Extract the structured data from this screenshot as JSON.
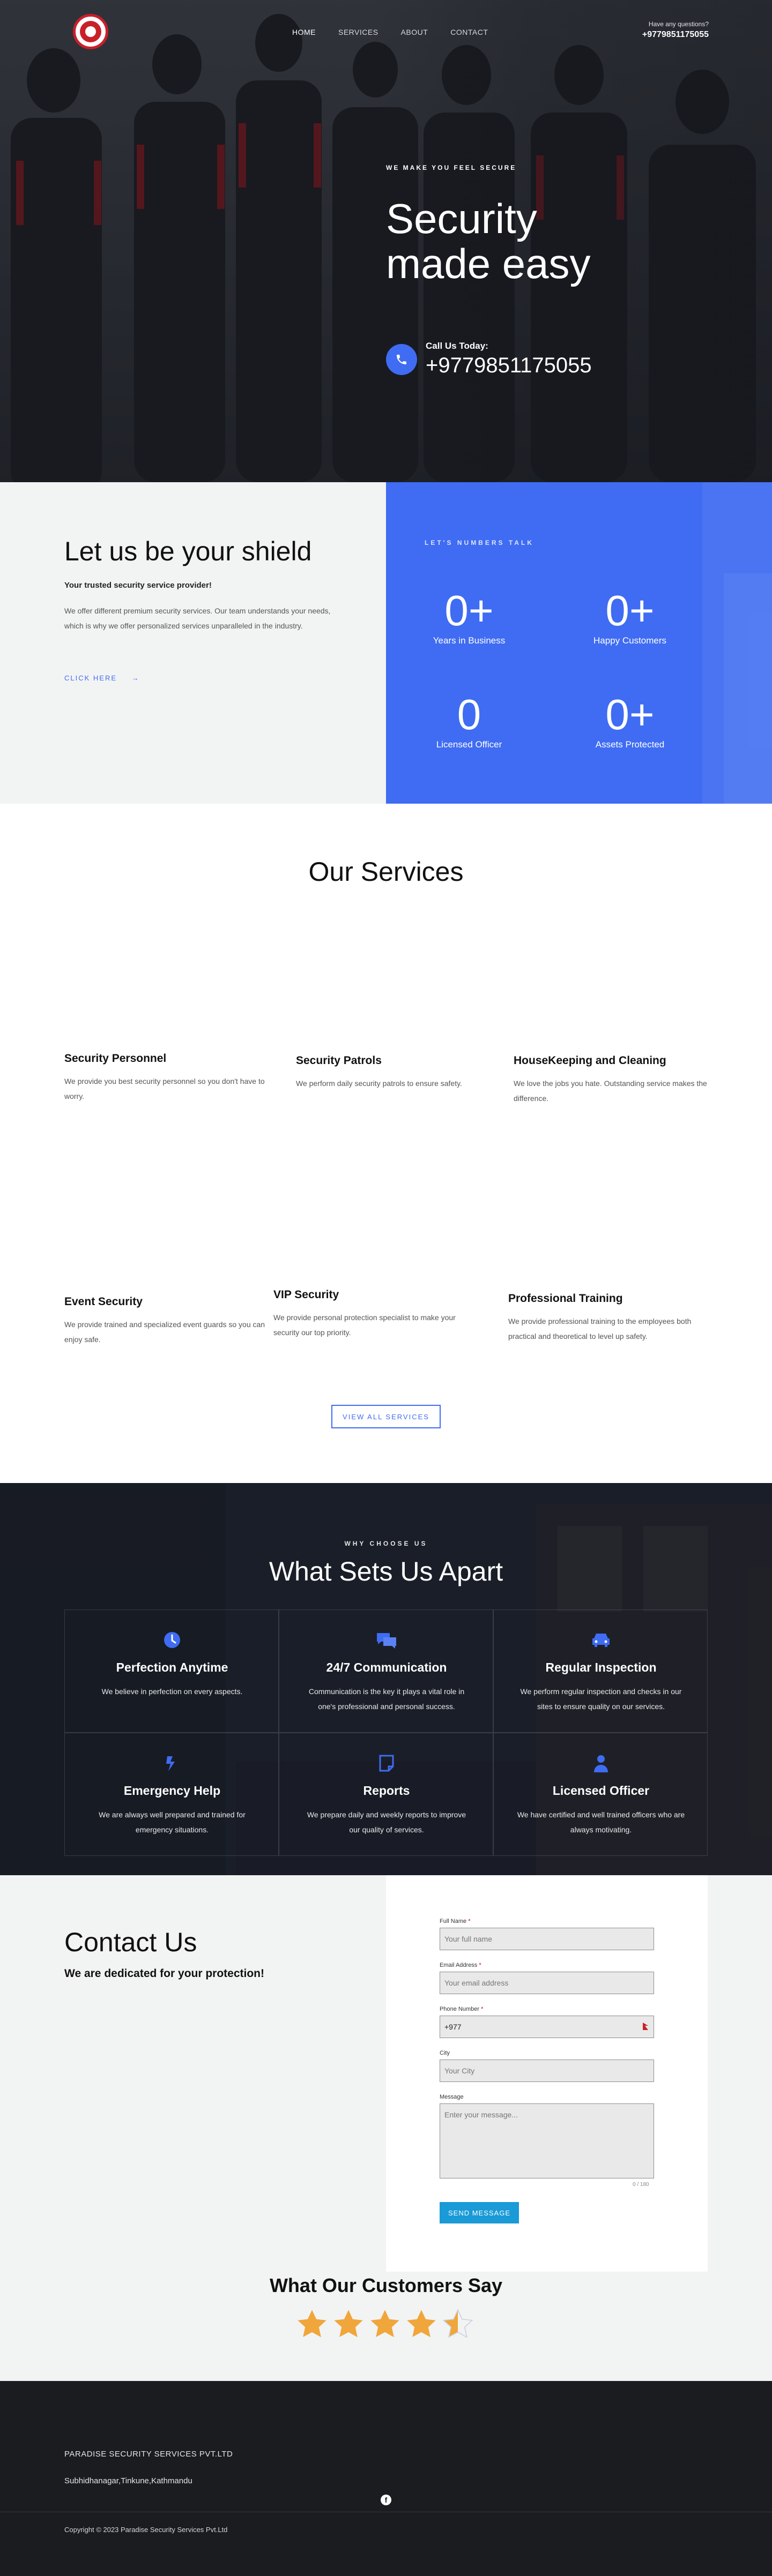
{
  "nav": {
    "items": [
      {
        "label": "HOME"
      },
      {
        "label": "SERVICES"
      },
      {
        "label": "ABOUT"
      },
      {
        "label": "CONTACT"
      }
    ],
    "questions_label": "Have any questions?",
    "phone": "+9779851175055"
  },
  "hero": {
    "kicker": "WE MAKE YOU FEEL SECURE",
    "title_line1": "Security",
    "title_line2": "made easy",
    "call_label": "Call Us Today:",
    "call_number": "+9779851175055"
  },
  "shield": {
    "title": "Let us be your shield",
    "subtitle": "Your trusted security service provider!",
    "body": "We offer different premium security services. Our team understands your needs, which is why we offer personalized services unparalleled in the industry.",
    "cta": "CLICK HERE"
  },
  "stats": {
    "kicker": "LET'S NUMBERS TALK",
    "items": [
      {
        "value": "0+",
        "label": "Years in Business"
      },
      {
        "value": "0+",
        "label": "Happy Customers"
      },
      {
        "value": "0",
        "label": "Licensed Officer"
      },
      {
        "value": "0+",
        "label": "Assets Protected"
      }
    ]
  },
  "services": {
    "title": "Our Services",
    "items": [
      {
        "title": "Security Personnel",
        "desc": "We provide you best security personnel so you don't have to worry."
      },
      {
        "title": "Security Patrols",
        "desc": "We perform daily security patrols to ensure safety."
      },
      {
        "title": "HouseKeeping and Cleaning",
        "desc": "We love the jobs you hate. Outstanding service makes the difference."
      },
      {
        "title": "Event Security",
        "desc": "We provide trained and specialized event guards so you can enjoy safe."
      },
      {
        "title": "VIP Security",
        "desc": "We provide personal protection specialist to make your security our top priority."
      },
      {
        "title": "Professional Training",
        "desc": "We provide professional training to the employees both practical and theoretical to level up safety."
      }
    ],
    "view_all": "VIEW ALL SERVICES"
  },
  "why": {
    "kicker": "WHY CHOOSE US",
    "title": "What Sets Us Apart",
    "items": [
      {
        "icon": "clock-icon",
        "title": "Perfection Anytime",
        "desc": "We believe in perfection on every aspects."
      },
      {
        "icon": "chat-icon",
        "title": "24/7 Communication",
        "desc": "Communication is the key it plays a vital role in one's professional and personal success."
      },
      {
        "icon": "car-icon",
        "title": "Regular Inspection",
        "desc": "We perform regular inspection and checks in our sites to ensure quality on our services."
      },
      {
        "icon": "first-aid-icon",
        "title": "Emergency Help",
        "desc": "We are always well prepared and trained for emergency situations."
      },
      {
        "icon": "report-icon",
        "title": "Reports",
        "desc": "We prepare daily and weekly reports to improve our quality of services."
      },
      {
        "icon": "officer-icon",
        "title": "Licensed Officer",
        "desc": "We have certified and well trained officers who are always motivating."
      }
    ]
  },
  "contact": {
    "title": "Contact Us",
    "tagline": "We are dedicated for your protection!",
    "fields": {
      "name_label": "Full Name",
      "name_placeholder": "Your full name",
      "email_label": "Email Address",
      "email_placeholder": "Your email address",
      "phone_label": "Phone Number",
      "phone_value": "+977",
      "city_label": "City",
      "city_placeholder": "Your City",
      "message_label": "Message",
      "message_placeholder": "Enter your message..."
    },
    "counter": "0 / 180",
    "send": "SEND MESSAGE"
  },
  "testimonials": {
    "title": "What Our Customers Say",
    "rating": 4.5
  },
  "footer": {
    "company": "PARADISE SECURITY SERVICES PVT.LTD",
    "address": "Subhidhanagar,Tinkune,Kathmandu",
    "facebook": "f",
    "copyright": "Copyright © 2023 Paradise Security Services Pvt.Ltd"
  },
  "colors": {
    "accent": "#3f6cf2",
    "send_button": "#1a9ad6",
    "star": "#f0a63a",
    "footer_bg": "#1a1c20"
  }
}
